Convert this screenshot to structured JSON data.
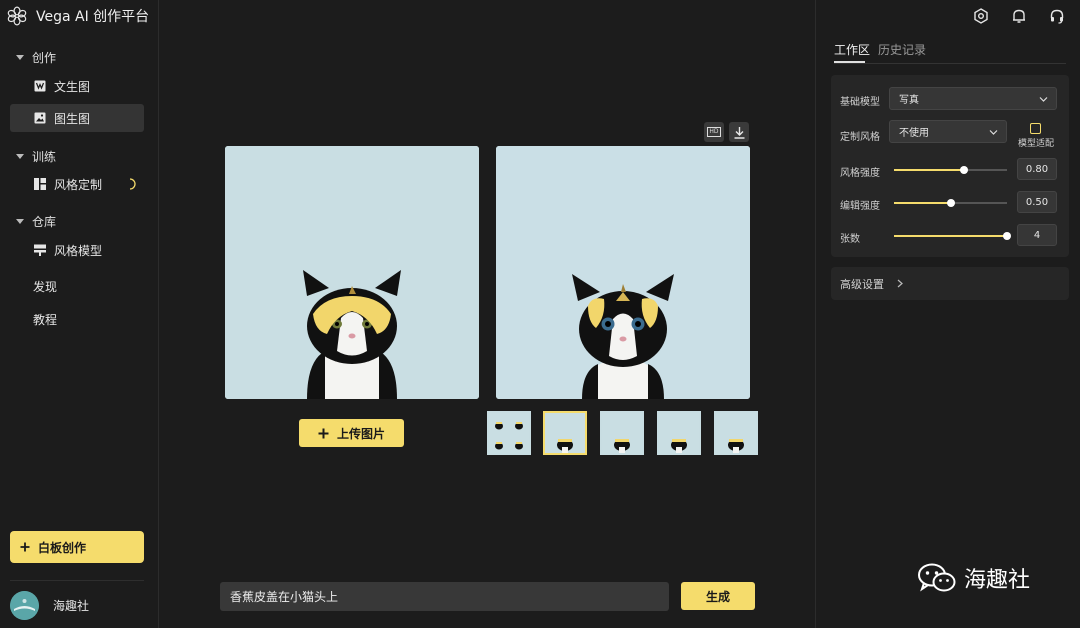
{
  "app": {
    "title": "Vega AI 创作平台"
  },
  "sidebar": {
    "sections": [
      {
        "label": "创作"
      },
      {
        "label": "训练"
      },
      {
        "label": "仓库"
      }
    ],
    "items": {
      "text2img": "文生图",
      "img2img": "图生图",
      "style_custom": "风格定制",
      "style_model": "风格模型"
    },
    "discover": "发现",
    "tutorial": "教程",
    "whiteboard_button": "白板创作",
    "user": {
      "name": "海趣社"
    }
  },
  "main": {
    "upload_button": "上传图片",
    "hd_label": "HD",
    "prompt": {
      "value": "香蕉皮盖在小猫头上"
    },
    "generate_button": "生成",
    "thumbnails_count": 5,
    "selected_thumbnail": 2
  },
  "right_panel": {
    "tabs": {
      "workspace": "工作区",
      "history": "历史记录"
    },
    "base_model": {
      "label": "基础模型",
      "value": "写真"
    },
    "custom_style": {
      "label": "定制风格",
      "value": "不使用"
    },
    "model_adapt": {
      "label": "模型适配",
      "checked": false
    },
    "style_strength": {
      "label": "风格强度",
      "value": "0.80",
      "fraction": 0.62
    },
    "edit_strength": {
      "label": "编辑强度",
      "value": "0.50",
      "fraction": 0.5
    },
    "count": {
      "label": "张数",
      "value": "4",
      "fraction": 1.0
    },
    "advanced": "高级设置"
  },
  "watermark": {
    "text": "海趣社"
  },
  "colors": {
    "accent": "#f5dc6c",
    "background": "#1c1c1c",
    "panel": "#262626",
    "image_bg": "#c8dde2"
  }
}
